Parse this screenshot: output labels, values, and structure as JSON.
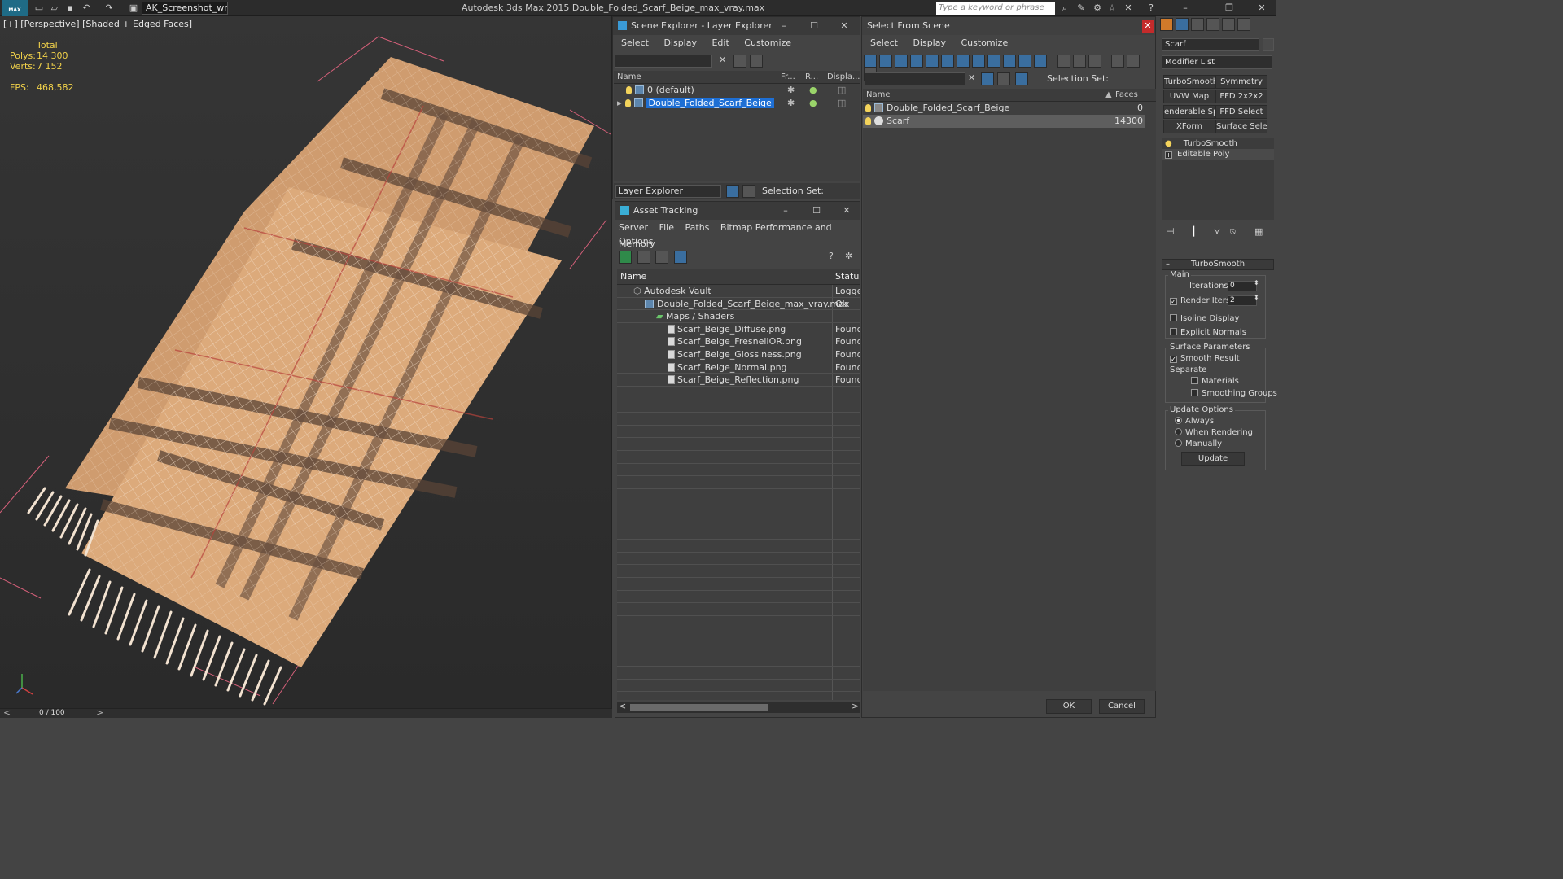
{
  "titlebar": {
    "workspace": "AK_Screenshot_wrksp",
    "app_title": "Autodesk 3ds Max  2015    Double_Folded_Scarf_Beige_max_vray.max",
    "search_placeholder": "Type a keyword or phrase"
  },
  "viewport": {
    "label": "[+] [Perspective] [Shaded + Edged Faces]",
    "stats_total": "Total",
    "polys_label": "Polys:",
    "polys_value": "14 300",
    "verts_label": "Verts:",
    "verts_value": "7 152",
    "fps_label": "FPS:",
    "fps_value": "468,582"
  },
  "timeline": {
    "frame": "0 / 100"
  },
  "scene_explorer": {
    "title": "Scene Explorer - Layer Explorer",
    "menu": [
      "Select",
      "Display",
      "Edit",
      "Customize"
    ],
    "columns": [
      "Name",
      "Fr...",
      "R...",
      "Displa..."
    ],
    "rows": [
      {
        "name": "0 (default)"
      },
      {
        "name": "Double_Folded_Scarf_Beige"
      }
    ],
    "footer_dropdown": "Layer Explorer",
    "selection_set": "Selection Set:"
  },
  "asset_tracking": {
    "title": "Asset Tracking",
    "menu": [
      "Server",
      "File",
      "Paths",
      "Bitmap Performance and Memory"
    ],
    "menu2": "Options",
    "columns": [
      "Name",
      "Status"
    ],
    "rows": [
      {
        "name": "Autodesk Vault",
        "status": "Logged"
      },
      {
        "name": "Double_Folded_Scarf_Beige_max_vray.max",
        "status": "Ok"
      },
      {
        "name": "Maps / Shaders",
        "status": ""
      },
      {
        "name": "Scarf_Beige_Diffuse.png",
        "status": "Found"
      },
      {
        "name": "Scarf_Beige_FresnelIOR.png",
        "status": "Found"
      },
      {
        "name": "Scarf_Beige_Glossiness.png",
        "status": "Found"
      },
      {
        "name": "Scarf_Beige_Normal.png",
        "status": "Found"
      },
      {
        "name": "Scarf_Beige_Reflection.png",
        "status": "Found"
      }
    ]
  },
  "select_from_scene": {
    "title": "Select From Scene",
    "menu": [
      "Select",
      "Display",
      "Customize"
    ],
    "selection_set": "Selection Set:",
    "columns": [
      "Name",
      "Faces"
    ],
    "rows": [
      {
        "name": "Double_Folded_Scarf_Beige",
        "faces": "0"
      },
      {
        "name": "Scarf",
        "faces": "14300"
      }
    ],
    "ok": "OK",
    "cancel": "Cancel"
  },
  "command_panel": {
    "object_name": "Scarf",
    "modifier_list": "Modifier List",
    "buttons": [
      "TurboSmooth",
      "Symmetry",
      "UVW Map",
      "FFD 2x2x2",
      "enderable Splin",
      "FFD Select",
      "XForm",
      "Surface Select"
    ],
    "stack": [
      "TurboSmooth",
      "Editable Poly"
    ],
    "rollout_title": "TurboSmooth",
    "main": "Main",
    "iterations_label": "Iterations:",
    "iterations": "0",
    "render_iters_label": "Render Iters:",
    "render_iters": "2",
    "isoline": "Isoline Display",
    "explicit_normals": "Explicit Normals",
    "surface_params": "Surface Parameters",
    "smooth_result": "Smooth Result",
    "separate": "Separate",
    "materials": "Materials",
    "smoothing_groups": "Smoothing Groups",
    "update_options": "Update Options",
    "always": "Always",
    "when_rendering": "When Rendering",
    "manually": "Manually",
    "update": "Update"
  }
}
